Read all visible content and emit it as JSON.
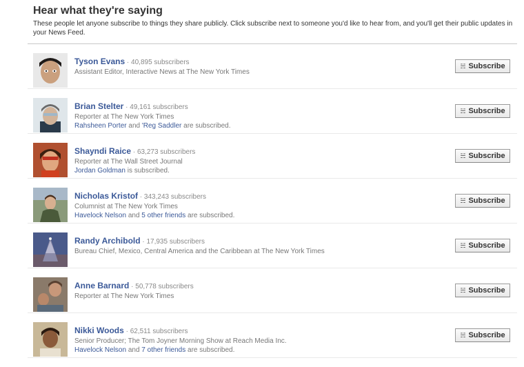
{
  "header": {
    "title": "Hear what they're saying",
    "description": "These people let anyone subscribe to things they share publicly. Click subscribe next to someone you'd like to hear from, and you'll get their public updates in your News Feed."
  },
  "subscribe_label": "Subscribe",
  "separator": "·",
  "people": [
    {
      "name": "Tyson Evans",
      "subscribers": "40,895 subscribers",
      "headline": "Assistant Editor, Interactive News at The New York Times",
      "friends": []
    },
    {
      "name": "Brian Stelter",
      "subscribers": "49,161 subscribers",
      "headline": "Reporter at The New York Times",
      "friends": [
        {
          "text": "Rahsheen Porter",
          "link": true
        },
        {
          "text": " and ",
          "link": false
        },
        {
          "text": "'Reg Saddler",
          "link": true
        },
        {
          "text": " are subscribed.",
          "link": false
        }
      ]
    },
    {
      "name": "Shayndi Raice",
      "subscribers": "63,273 subscribers",
      "headline": "Reporter at The Wall Street Journal",
      "friends": [
        {
          "text": "Jordan Goldman",
          "link": true
        },
        {
          "text": " is subscribed.",
          "link": false
        }
      ]
    },
    {
      "name": "Nicholas Kristof",
      "subscribers": "343,243 subscribers",
      "headline": "Columnist at The New York Times",
      "friends": [
        {
          "text": "Havelock Nelson",
          "link": true
        },
        {
          "text": " and ",
          "link": false
        },
        {
          "text": "5 other friends",
          "link": true
        },
        {
          "text": " are subscribed.",
          "link": false
        }
      ]
    },
    {
      "name": "Randy Archibold",
      "subscribers": "17,935 subscribers",
      "headline": "Bureau Chief, Mexico, Central America and the Caribbean at The New York Times",
      "friends": []
    },
    {
      "name": "Anne Barnard",
      "subscribers": "50,778 subscribers",
      "headline": "Reporter at The New York Times",
      "friends": []
    },
    {
      "name": "Nikki Woods",
      "subscribers": "62,511 subscribers",
      "headline": "Senior Producer; The Tom Joyner Morning Show at Reach Media Inc.",
      "friends": [
        {
          "text": "Havelock Nelson",
          "link": true
        },
        {
          "text": " and ",
          "link": false
        },
        {
          "text": "7 other friends",
          "link": true
        },
        {
          "text": " are subscribed.",
          "link": false
        }
      ]
    }
  ]
}
